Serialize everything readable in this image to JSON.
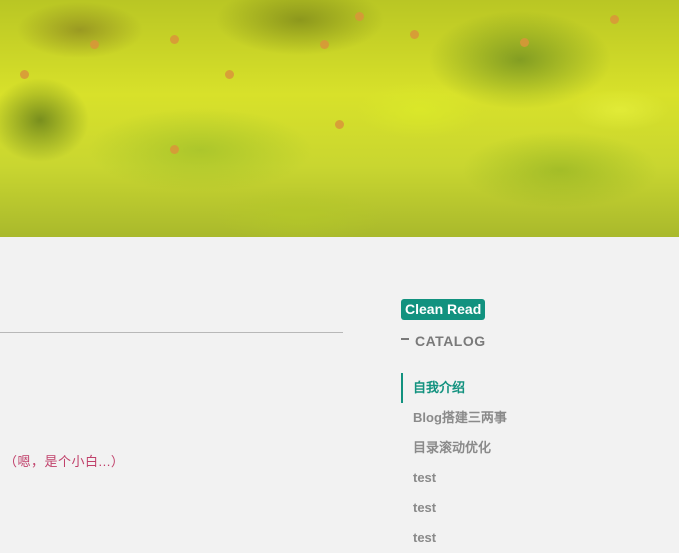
{
  "header_image": {
    "icon": "flower-field-image"
  },
  "content": {
    "note": "（嗯，是个小白...）"
  },
  "sidebar": {
    "clean_read_label": "Clean Read",
    "catalog_title": "CATALOG",
    "toc": [
      {
        "label": "自我介绍",
        "active": true
      },
      {
        "label": "Blog搭建三两事",
        "active": false
      },
      {
        "label": "目录滚动优化",
        "active": false
      },
      {
        "label": "test",
        "active": false
      },
      {
        "label": "test",
        "active": false
      },
      {
        "label": "test",
        "active": false
      }
    ]
  },
  "colors": {
    "accent": "#12927f",
    "note": "#c0406a",
    "muted": "#8a8a8a"
  }
}
